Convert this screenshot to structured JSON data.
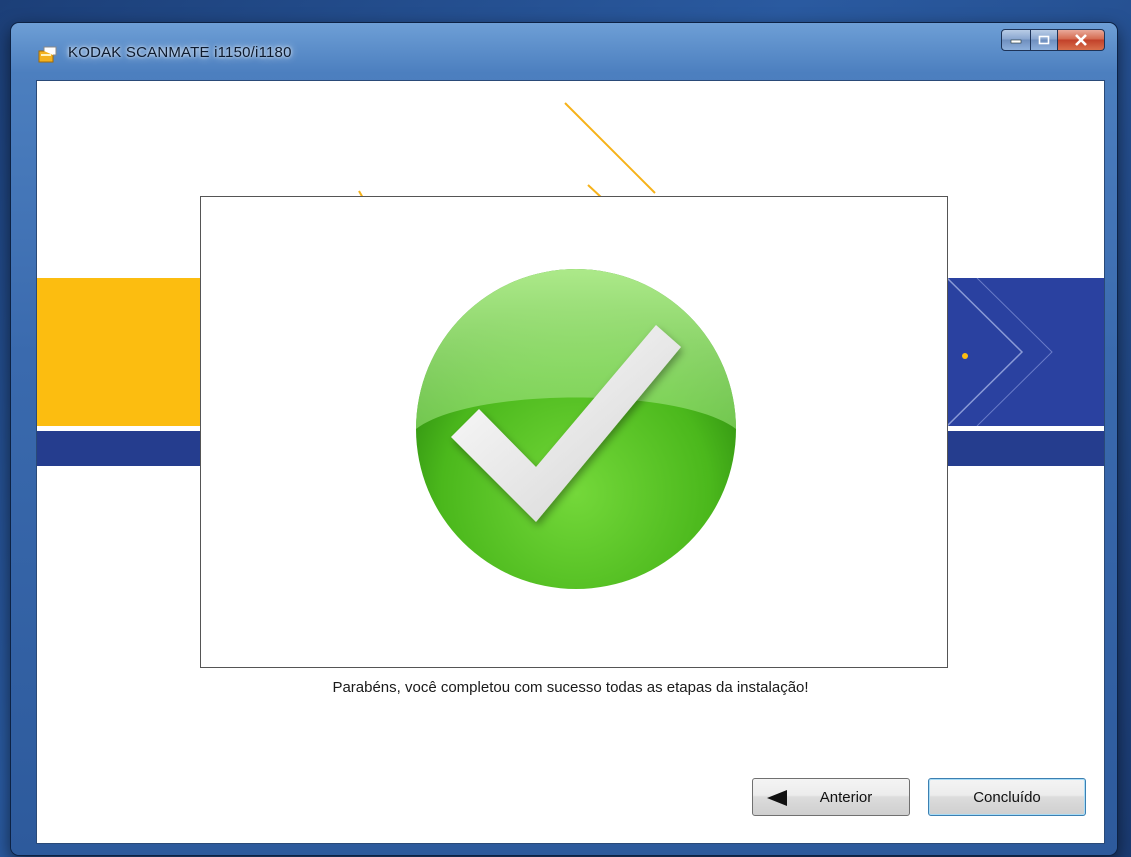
{
  "window": {
    "title": "KODAK SCANMATE i1150/i1180",
    "icon": "installer-icon"
  },
  "caption_buttons": {
    "minimize": "minimize-icon",
    "maximize": "maximize-icon",
    "close": "close-icon"
  },
  "content": {
    "status_icon": "success-checkmark-icon",
    "message": "Parabéns, você completou com sucesso todas as etapas da instalação!"
  },
  "buttons": {
    "previous_label": "Anterior",
    "previous_icon": "back-arrow-icon",
    "finish_label": "Concluído"
  },
  "colors": {
    "accent_yellow": "#fcbd10",
    "accent_blue": "#2a41a0",
    "check_green": "#4fbf1f"
  }
}
